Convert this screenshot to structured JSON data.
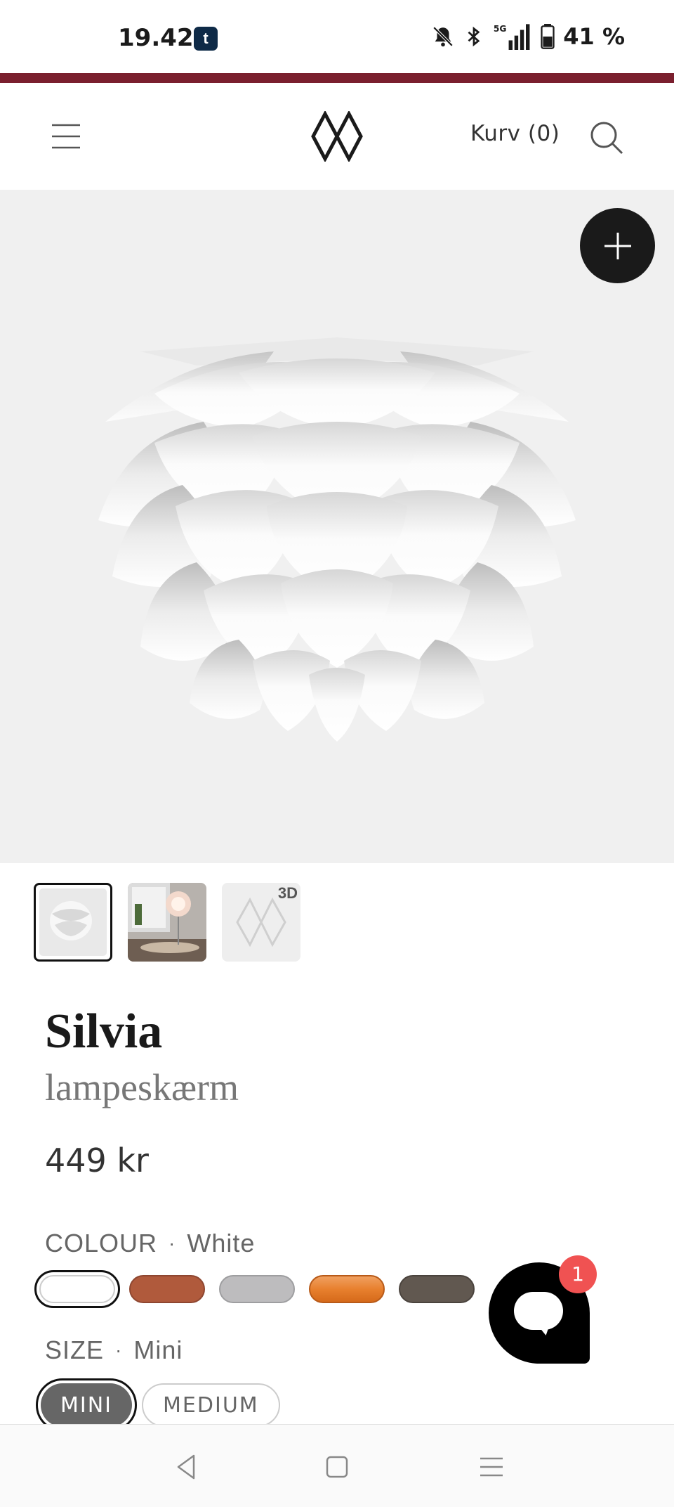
{
  "status_bar": {
    "time": "19.42",
    "app_icon_letter": "t",
    "battery_text": "41 %",
    "icons": [
      "bell-off-icon",
      "bluetooth-icon",
      "signal-5g-icon",
      "battery-icon"
    ]
  },
  "header": {
    "cart_label": "Kurv (0)",
    "icons": [
      "menu-icon",
      "logo-diamond-icon",
      "search-icon"
    ]
  },
  "gallery": {
    "thumbnails": [
      {
        "label": "",
        "type": "product-photo"
      },
      {
        "label": "",
        "type": "room-photo"
      },
      {
        "label": "3D",
        "type": "3d-view"
      }
    ]
  },
  "product": {
    "name": "Silvia",
    "type": "lampeskærm",
    "price": "449 kr"
  },
  "colour": {
    "label": "COLOUR",
    "separator": "·",
    "selected": "White",
    "swatches": [
      "#ffffff",
      "#b05a3c",
      "#bdbcbe",
      "#e8802e",
      "#615850"
    ]
  },
  "size": {
    "label": "SIZE",
    "separator": "·",
    "selected": "Mini",
    "options": [
      "MINI",
      "MEDIUM"
    ]
  },
  "chat": {
    "badge_count": "1"
  },
  "colors": {
    "accent": "#7a1f2e",
    "badge": "#f05252"
  }
}
